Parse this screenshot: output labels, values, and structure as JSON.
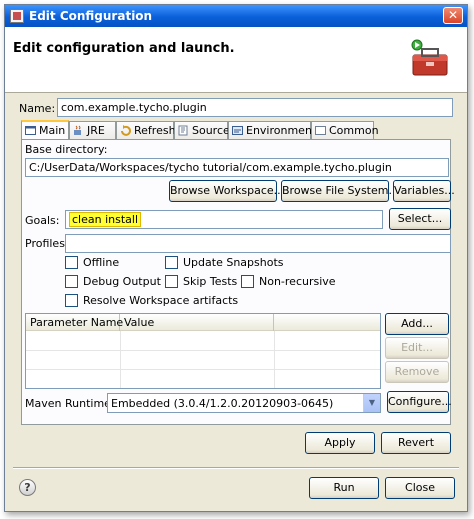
{
  "window": {
    "title": "Edit Configuration"
  },
  "header": {
    "title": "Edit configuration and launch."
  },
  "name": {
    "label": "Name:",
    "value": "com.example.tycho.plugin"
  },
  "tabs": [
    {
      "label": "Main",
      "icon": "main-tab-icon"
    },
    {
      "label": "JRE",
      "icon": "jre-icon"
    },
    {
      "label": "Refresh",
      "icon": "refresh-icon"
    },
    {
      "label": "Source",
      "icon": "source-icon"
    },
    {
      "label": "Environment",
      "icon": "environment-icon"
    },
    {
      "label": "Common",
      "icon": "common-icon"
    }
  ],
  "base_directory": {
    "label": "Base directory:",
    "value": "C:/UserData/Workspaces/tycho tutorial/com.example.tycho.plugin",
    "browse_workspace": "Browse Workspace...",
    "browse_file_system": "Browse File System...",
    "variables": "Variables..."
  },
  "goals": {
    "label": "Goals:",
    "value": "clean install",
    "select": "Select...",
    "highlight": "#ffff33"
  },
  "profiles": {
    "label": "Profiles:",
    "value": ""
  },
  "options": {
    "offline": "Offline",
    "update_snapshots": "Update Snapshots",
    "debug_output": "Debug Output",
    "skip_tests": "Skip Tests",
    "non_recursive": "Non-recursive",
    "resolve_workspace": "Resolve Workspace artifacts"
  },
  "params": {
    "columns": [
      "Parameter Name",
      "Value"
    ],
    "add": "Add...",
    "edit": "Edit...",
    "remove": "Remove"
  },
  "maven_runtime": {
    "label": "Maven Runtime:",
    "value": "Embedded (3.0.4/1.2.0.20120903-0645)",
    "configure": "Configure..."
  },
  "footer": {
    "apply": "Apply",
    "revert": "Revert",
    "run": "Run",
    "close": "Close",
    "help": "?"
  },
  "colors": {
    "titlebar": "#0a5fd8",
    "tab_active_accent": "#ffc83c",
    "toolbox_red": "#c0392b"
  }
}
